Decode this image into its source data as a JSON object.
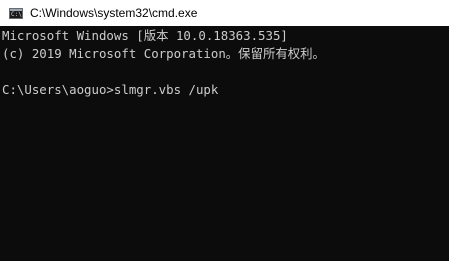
{
  "window": {
    "title": "C:\\Windows\\system32\\cmd.exe",
    "icon": "cmd-console-icon",
    "icon_glyph": "C:\\"
  },
  "console": {
    "lines": [
      "Microsoft Windows [版本 10.0.18363.535]",
      "(c) 2019 Microsoft Corporation。保留所有权利。",
      "",
      "C:\\Users\\aoguo>slmgr.vbs /upk"
    ]
  },
  "colors": {
    "background": "#0c0c0c",
    "text": "#cccccc",
    "titlebar": "#ffffff"
  }
}
